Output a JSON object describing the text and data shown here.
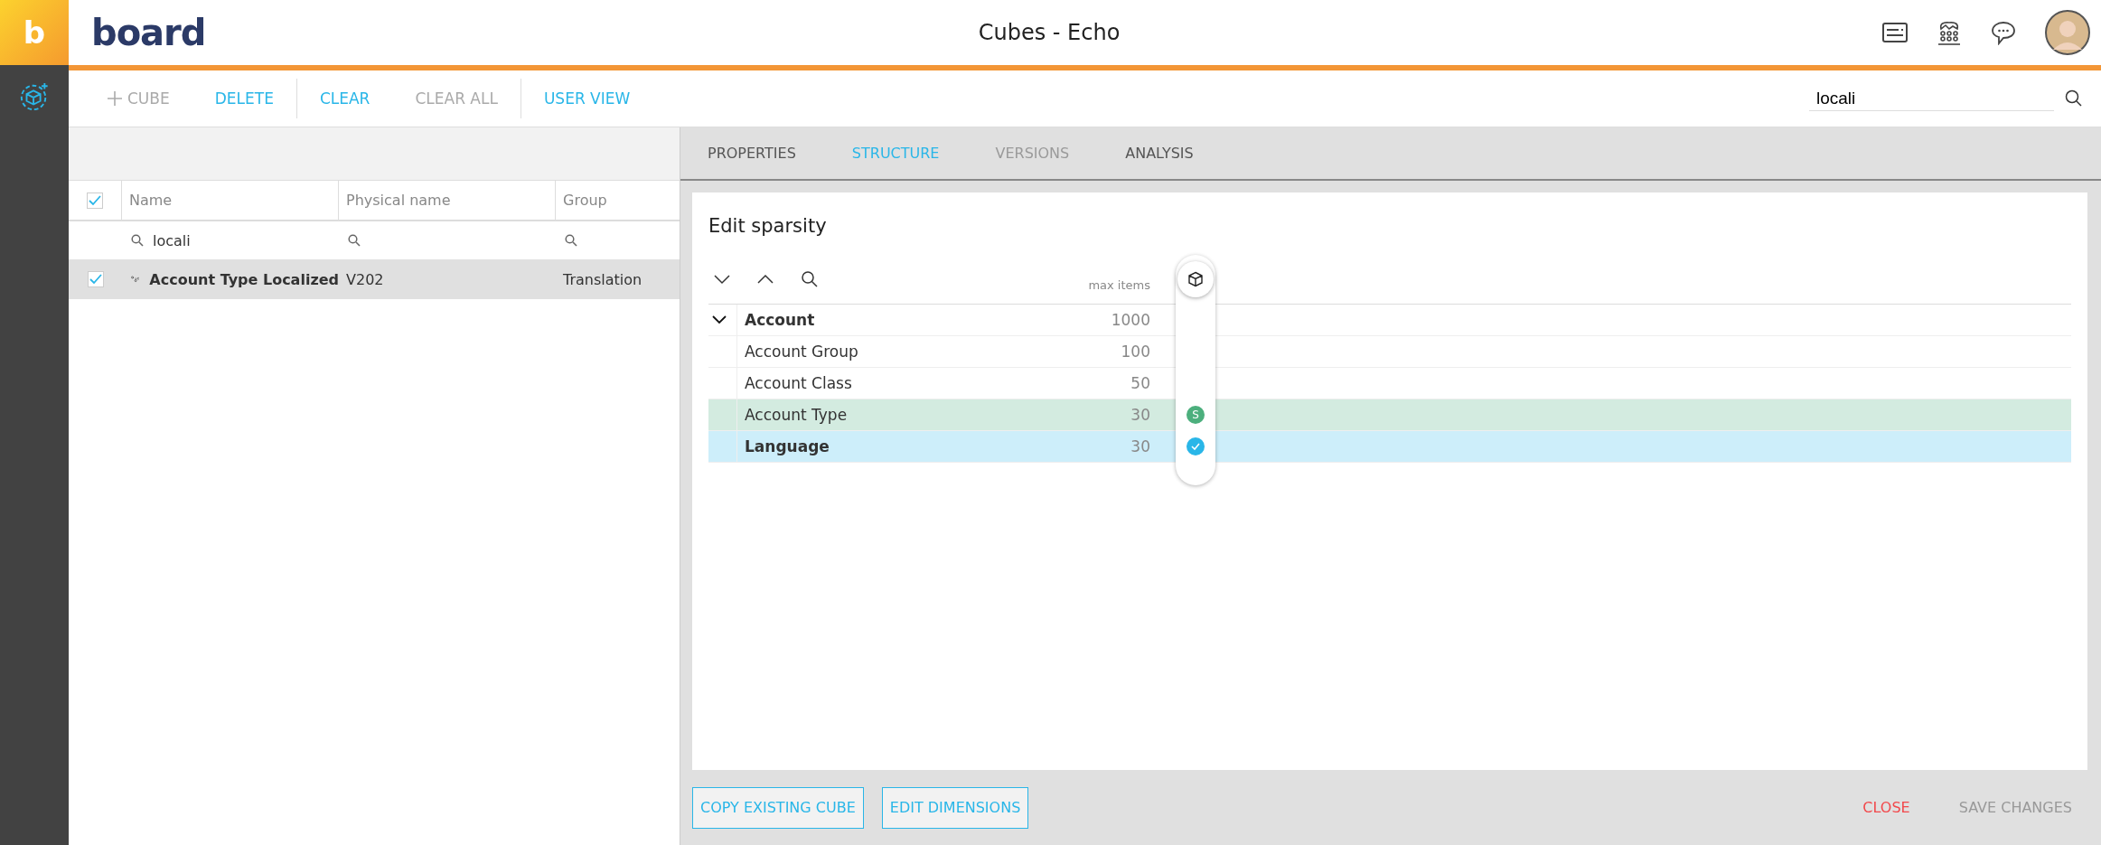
{
  "app_badge": "b",
  "logo": "board",
  "window": {
    "title": "Cubes - Echo"
  },
  "toolbar": [
    [
      {
        "label": "CUBE",
        "kind": "add",
        "disabled": true
      },
      {
        "label": "DELETE",
        "kind": "text",
        "disabled": false
      }
    ],
    [
      {
        "label": "CLEAR",
        "kind": "text",
        "disabled": false
      },
      {
        "label": "CLEAR ALL",
        "kind": "text",
        "disabled": true
      }
    ],
    [
      {
        "label": "USER VIEW",
        "kind": "text",
        "disabled": false
      }
    ]
  ],
  "search": {
    "value": "locali"
  },
  "cube_table": {
    "all_checked": true,
    "columns": [
      "Name",
      "Physical name",
      "Group"
    ],
    "name_filter": "locali",
    "rows": [
      {
        "checked": true,
        "selected": true,
        "name": "Account Type Localized",
        "physical_name": "V202",
        "group": "Translation"
      }
    ]
  },
  "tabs": [
    {
      "label": "PROPERTIES",
      "selected": false,
      "disabled": false
    },
    {
      "label": "STRUCTURE",
      "selected": true,
      "disabled": false
    },
    {
      "label": "VERSIONS",
      "selected": false,
      "disabled": true
    },
    {
      "label": "ANALYSIS",
      "selected": false,
      "disabled": false
    }
  ],
  "sparsity": {
    "title": "Edit sparsity",
    "max_items_label": "max items",
    "tree": [
      {
        "name": "Account",
        "max_items": "1000",
        "expanded": true,
        "children": [
          {
            "name": "Account Group",
            "max_items": "100",
            "selected": false,
            "sparse": false,
            "dense": false
          },
          {
            "name": "Account Class",
            "max_items": "50",
            "selected": false,
            "sparse": false,
            "dense": false
          },
          {
            "name": "Account Type",
            "max_items": "30",
            "selected": false,
            "sparse": true,
            "dense": false,
            "badge": "S"
          },
          {
            "name": "Language",
            "max_items": "30",
            "selected": true,
            "sparse": false,
            "dense": true
          }
        ]
      }
    ]
  },
  "footer": [
    {
      "label": "COPY EXISTING CUBE",
      "kind": "outline",
      "disabled": false
    },
    {
      "label": "EDIT DIMENSIONS",
      "kind": "outline",
      "disabled": false
    },
    {
      "label": "CLOSE",
      "kind": "danger",
      "disabled": false
    },
    {
      "label": "SAVE CHANGES",
      "kind": "text",
      "disabled": true
    }
  ]
}
